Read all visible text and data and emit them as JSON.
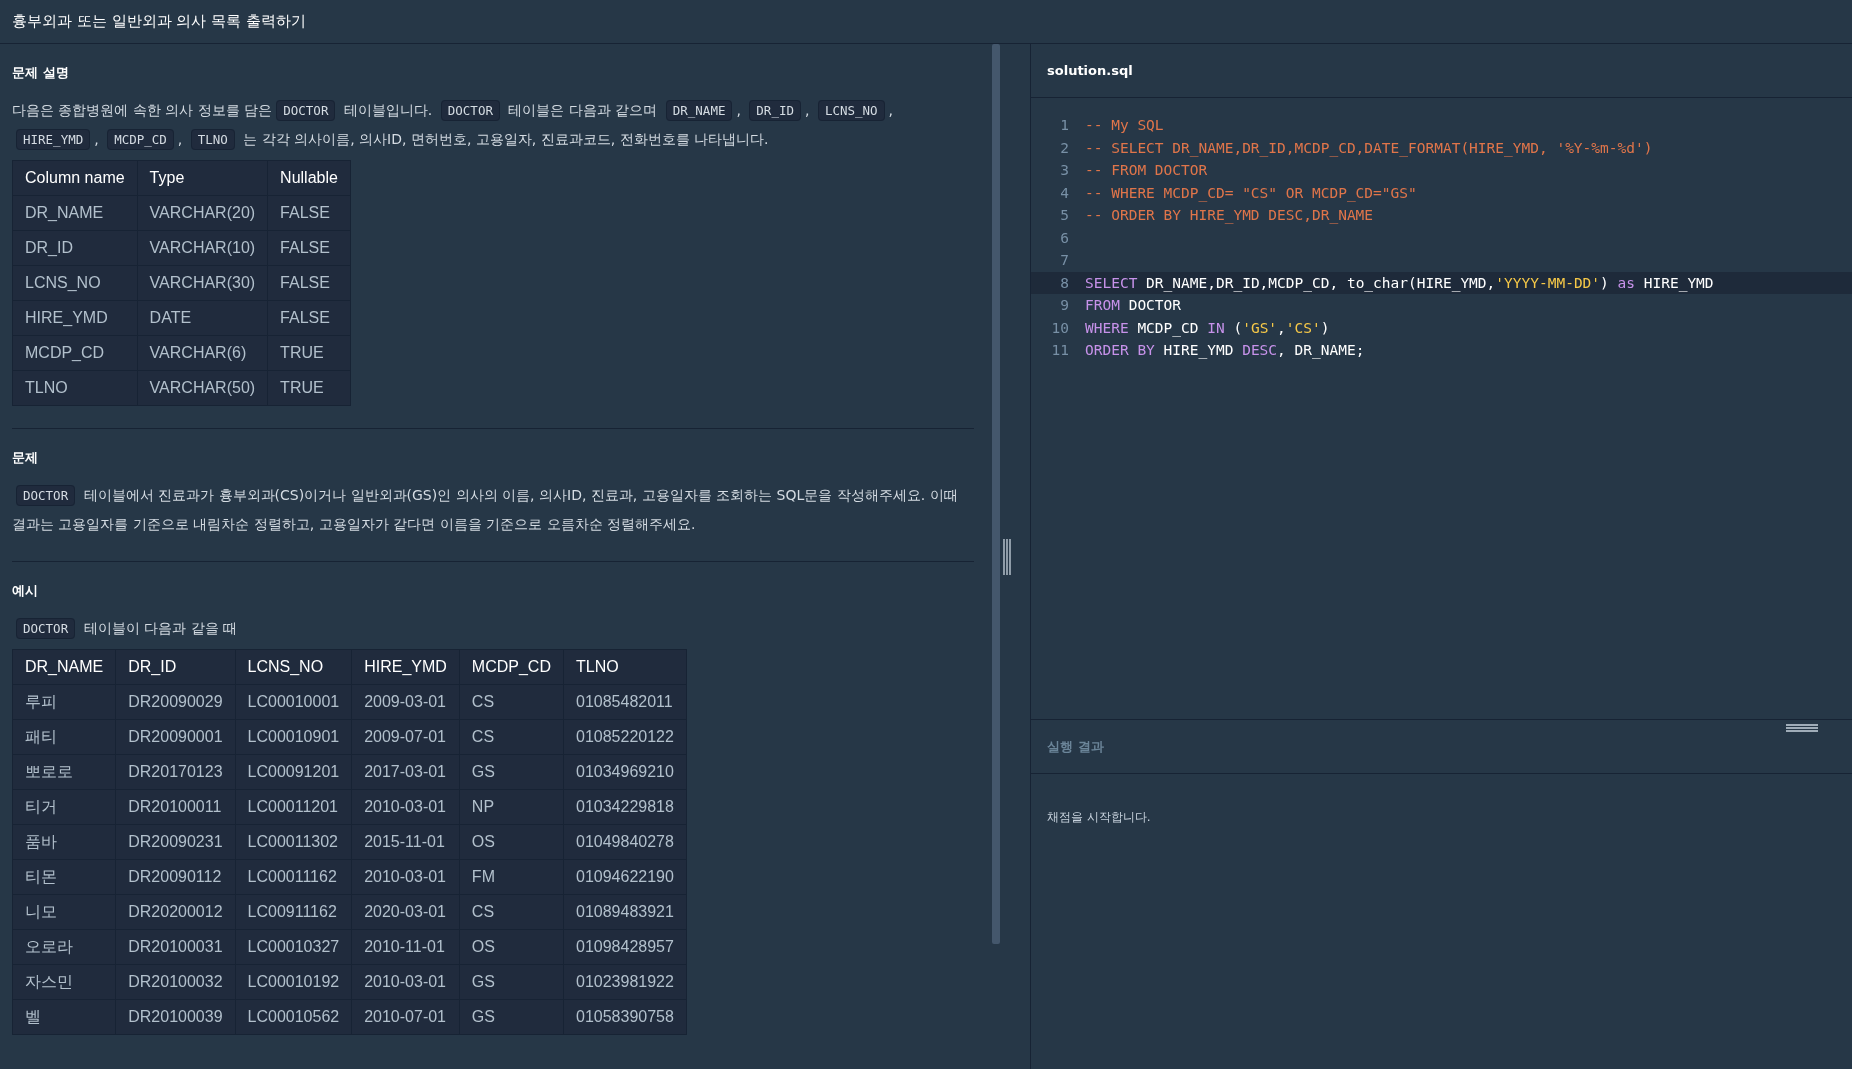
{
  "header": {
    "title": "흉부외과 또는 일반외과 의사 목록 출력하기"
  },
  "sections": [
    {
      "title": "문제 설명",
      "blocks": [
        {
          "kind": "paragraph",
          "segments": [
            {
              "kind": "text",
              "text": "다음은 종합병원에 속한 의사 정보를 담은"
            },
            {
              "kind": "code",
              "text": "DOCTOR"
            },
            {
              "kind": "text",
              "text": " 테이블입니다. "
            },
            {
              "kind": "code",
              "text": "DOCTOR"
            },
            {
              "kind": "text",
              "text": " 테이블은 다음과 같으며 "
            },
            {
              "kind": "code",
              "text": "DR_NAME"
            },
            {
              "kind": "text",
              "text": ", "
            },
            {
              "kind": "code",
              "text": "DR_ID"
            },
            {
              "kind": "text",
              "text": ", "
            },
            {
              "kind": "code",
              "text": "LCNS_NO"
            },
            {
              "kind": "text",
              "text": ", "
            },
            {
              "kind": "code",
              "text": "HIRE_YMD"
            },
            {
              "kind": "text",
              "text": ", "
            },
            {
              "kind": "code",
              "text": "MCDP_CD"
            },
            {
              "kind": "text",
              "text": ", "
            },
            {
              "kind": "code",
              "text": "TLNO"
            },
            {
              "kind": "text",
              "text": " 는 각각 의사이름, 의사ID, 면허번호, 고용일자, 진료과코드, 전화번호를 나타냅니다."
            }
          ]
        },
        {
          "kind": "table",
          "columns": [
            "Column name",
            "Type",
            "Nullable"
          ],
          "rows": [
            [
              "DR_NAME",
              "VARCHAR(20)",
              "FALSE"
            ],
            [
              "DR_ID",
              "VARCHAR(10)",
              "FALSE"
            ],
            [
              "LCNS_NO",
              "VARCHAR(30)",
              "FALSE"
            ],
            [
              "HIRE_YMD",
              "DATE",
              "FALSE"
            ],
            [
              "MCDP_CD",
              "VARCHAR(6)",
              "TRUE"
            ],
            [
              "TLNO",
              "VARCHAR(50)",
              "TRUE"
            ]
          ]
        }
      ]
    },
    {
      "title": "문제",
      "blocks": [
        {
          "kind": "paragraph",
          "segments": [
            {
              "kind": "code",
              "text": "DOCTOR"
            },
            {
              "kind": "text",
              "text": " 테이블에서 진료과가 흉부외과(CS)이거나 일반외과(GS)인 의사의 이름, 의사ID, 진료과, 고용일자를 조회하는 SQL문을 작성해주세요. 이때 결과는 고용일자를 기준으로 내림차순 정렬하고, 고용일자가 같다면 이름을 기준으로 오름차순 정렬해주세요."
            }
          ]
        }
      ]
    },
    {
      "title": "예시",
      "blocks": [
        {
          "kind": "paragraph",
          "segments": [
            {
              "kind": "code",
              "text": "DOCTOR"
            },
            {
              "kind": "text",
              "text": " 테이블이 다음과 같을 때"
            }
          ]
        },
        {
          "kind": "table",
          "columns": [
            "DR_NAME",
            "DR_ID",
            "LCNS_NO",
            "HIRE_YMD",
            "MCDP_CD",
            "TLNO"
          ],
          "rows": [
            [
              "루피",
              "DR20090029",
              "LC00010001",
              "2009-03-01",
              "CS",
              "01085482011"
            ],
            [
              "패티",
              "DR20090001",
              "LC00010901",
              "2009-07-01",
              "CS",
              "01085220122"
            ],
            [
              "뽀로로",
              "DR20170123",
              "LC00091201",
              "2017-03-01",
              "GS",
              "01034969210"
            ],
            [
              "티거",
              "DR20100011",
              "LC00011201",
              "2010-03-01",
              "NP",
              "01034229818"
            ],
            [
              "품바",
              "DR20090231",
              "LC00011302",
              "2015-11-01",
              "OS",
              "01049840278"
            ],
            [
              "티몬",
              "DR20090112",
              "LC00011162",
              "2010-03-01",
              "FM",
              "01094622190"
            ],
            [
              "니모",
              "DR20200012",
              "LC00911162",
              "2020-03-01",
              "CS",
              "01089483921"
            ],
            [
              "오로라",
              "DR20100031",
              "LC00010327",
              "2010-11-01",
              "OS",
              "01098428957"
            ],
            [
              "자스민",
              "DR20100032",
              "LC00010192",
              "2010-03-01",
              "GS",
              "01023981922"
            ],
            [
              "벨",
              "DR20100039",
              "LC00010562",
              "2010-07-01",
              "GS",
              "01058390758"
            ]
          ]
        }
      ]
    }
  ],
  "editor": {
    "filename": "solution.sql",
    "lines": [
      {
        "number": "1",
        "active": false,
        "tokens": [
          {
            "kind": "comment",
            "text": "-- My SQL"
          }
        ]
      },
      {
        "number": "2",
        "active": false,
        "tokens": [
          {
            "kind": "comment",
            "text": "-- SELECT DR_NAME,DR_ID,MCDP_CD,DATE_FORMAT(HIRE_YMD, '%Y-%m-%d')"
          }
        ]
      },
      {
        "number": "3",
        "active": false,
        "tokens": [
          {
            "kind": "comment",
            "text": "-- FROM DOCTOR"
          }
        ]
      },
      {
        "number": "4",
        "active": false,
        "tokens": [
          {
            "kind": "comment",
            "text": "-- WHERE MCDP_CD= \"CS\" OR MCDP_CD=\"GS\""
          }
        ]
      },
      {
        "number": "5",
        "active": false,
        "tokens": [
          {
            "kind": "comment",
            "text": "-- ORDER BY HIRE_YMD DESC,DR_NAME"
          }
        ]
      },
      {
        "number": "6",
        "active": false
      },
      {
        "number": "7",
        "active": false
      },
      {
        "number": "8",
        "active": true,
        "tokens": [
          {
            "kind": "keyword",
            "text": "SELECT"
          },
          {
            "kind": "plain",
            "text": " DR_NAME,DR_ID,MCDP_CD, to_char(HIRE_YMD,"
          },
          {
            "kind": "string",
            "text": "'YYYY-MM-DD'"
          },
          {
            "kind": "plain",
            "text": ") "
          },
          {
            "kind": "keyword",
            "text": "as"
          },
          {
            "kind": "plain",
            "text": " HIRE_YMD"
          }
        ]
      },
      {
        "number": "9",
        "active": false,
        "tokens": [
          {
            "kind": "keyword",
            "text": "FROM"
          },
          {
            "kind": "plain",
            "text": " DOCTOR"
          }
        ]
      },
      {
        "number": "10",
        "active": false,
        "tokens": [
          {
            "kind": "keyword",
            "text": "WHERE"
          },
          {
            "kind": "plain",
            "text": " MCDP_CD "
          },
          {
            "kind": "keyword",
            "text": "IN"
          },
          {
            "kind": "plain",
            "text": " ("
          },
          {
            "kind": "string",
            "text": "'GS'"
          },
          {
            "kind": "plain",
            "text": ","
          },
          {
            "kind": "string",
            "text": "'CS'"
          },
          {
            "kind": "plain",
            "text": ")"
          }
        ]
      },
      {
        "number": "11",
        "active": false,
        "tokens": [
          {
            "kind": "keyword",
            "text": "ORDER BY"
          },
          {
            "kind": "plain",
            "text": " HIRE_YMD "
          },
          {
            "kind": "keyword",
            "text": "DESC"
          },
          {
            "kind": "plain",
            "text": ", DR_NAME;"
          }
        ]
      }
    ]
  },
  "result": {
    "title": "실행 결과",
    "message": "채점을 시작합니다."
  }
}
